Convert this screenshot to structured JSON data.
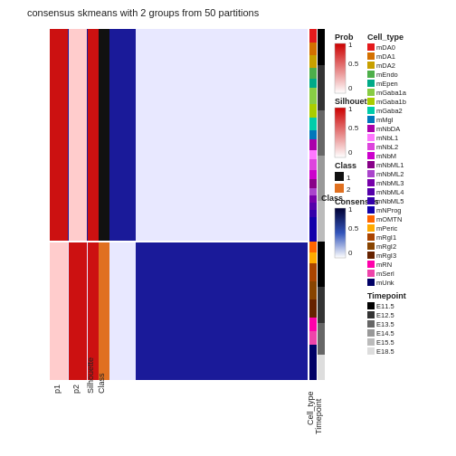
{
  "title": "consensus skmeans with 2 groups from 50 partitions",
  "col_labels": [
    "p1",
    "p2",
    "Silhouette",
    "Class"
  ],
  "col_label_rotated": true,
  "legend": {
    "prob": {
      "label": "Prob",
      "values": [
        "1",
        "0.5",
        "0"
      ],
      "colors": [
        "#cc0000",
        "#ff9999",
        "#ffffff"
      ]
    },
    "silhouette": {
      "label": "Silhouette",
      "values": [
        "1",
        "0.5",
        "0"
      ],
      "colors": [
        "#cc0000",
        "#ff9999",
        "#ffffff"
      ]
    },
    "class": {
      "label": "Class",
      "values": [
        "1",
        "2"
      ],
      "colors": [
        "#000000",
        "#e07020"
      ]
    },
    "consensus": {
      "label": "Consensus",
      "values": [
        "1",
        "0.5",
        "0"
      ],
      "colors": [
        "#000033",
        "#3355bb",
        "#ffffff"
      ]
    }
  },
  "cell_type_legend": {
    "title": "Cell_type",
    "items": [
      {
        "label": "mDA0",
        "color": "#e41a1c"
      },
      {
        "label": "mDA1",
        "color": "#d47000"
      },
      {
        "label": "mDA2",
        "color": "#c8a000"
      },
      {
        "label": "mEndo",
        "color": "#4daf4a"
      },
      {
        "label": "mEpen",
        "color": "#00aa88"
      },
      {
        "label": "mGaba1a",
        "color": "#88cc44"
      },
      {
        "label": "mGaba1b",
        "color": "#aacc00"
      },
      {
        "label": "mGaba2",
        "color": "#00ccaa"
      },
      {
        "label": "mMgl",
        "color": "#0077bb"
      },
      {
        "label": "mNbDA",
        "color": "#aa00aa"
      },
      {
        "label": "mNbL1",
        "color": "#ff77ff"
      },
      {
        "label": "mNbL2",
        "color": "#dd44dd"
      },
      {
        "label": "mNbM",
        "color": "#cc00cc"
      },
      {
        "label": "mNbML1",
        "color": "#880088"
      },
      {
        "label": "mNbML2",
        "color": "#aa44cc"
      },
      {
        "label": "mNbML3",
        "color": "#7700aa"
      },
      {
        "label": "mNbML4",
        "color": "#5500aa"
      },
      {
        "label": "mNbML5",
        "color": "#3300aa"
      },
      {
        "label": "mNProg",
        "color": "#1100aa"
      },
      {
        "label": "mOMTN",
        "color": "#ff6600"
      },
      {
        "label": "mPeric",
        "color": "#ffaa00"
      },
      {
        "label": "mRgI1",
        "color": "#aa4400"
      },
      {
        "label": "mRgI2",
        "color": "#884400"
      },
      {
        "label": "mRgI3",
        "color": "#662200"
      },
      {
        "label": "mRN",
        "color": "#ff00aa"
      },
      {
        "label": "mSerl",
        "color": "#ee44aa"
      },
      {
        "label": "mUnk",
        "color": "#000066"
      }
    ]
  },
  "timepoint_legend": {
    "title": "Timepoint",
    "items": [
      {
        "label": "E11.5",
        "color": "#000000"
      },
      {
        "label": "E12.5",
        "color": "#333333"
      },
      {
        "label": "E13.5",
        "color": "#666666"
      },
      {
        "label": "E14.5",
        "color": "#999999"
      },
      {
        "label": "E15.5",
        "color": "#bbbbbb"
      },
      {
        "label": "E18.5",
        "color": "#dddddd"
      }
    ]
  }
}
